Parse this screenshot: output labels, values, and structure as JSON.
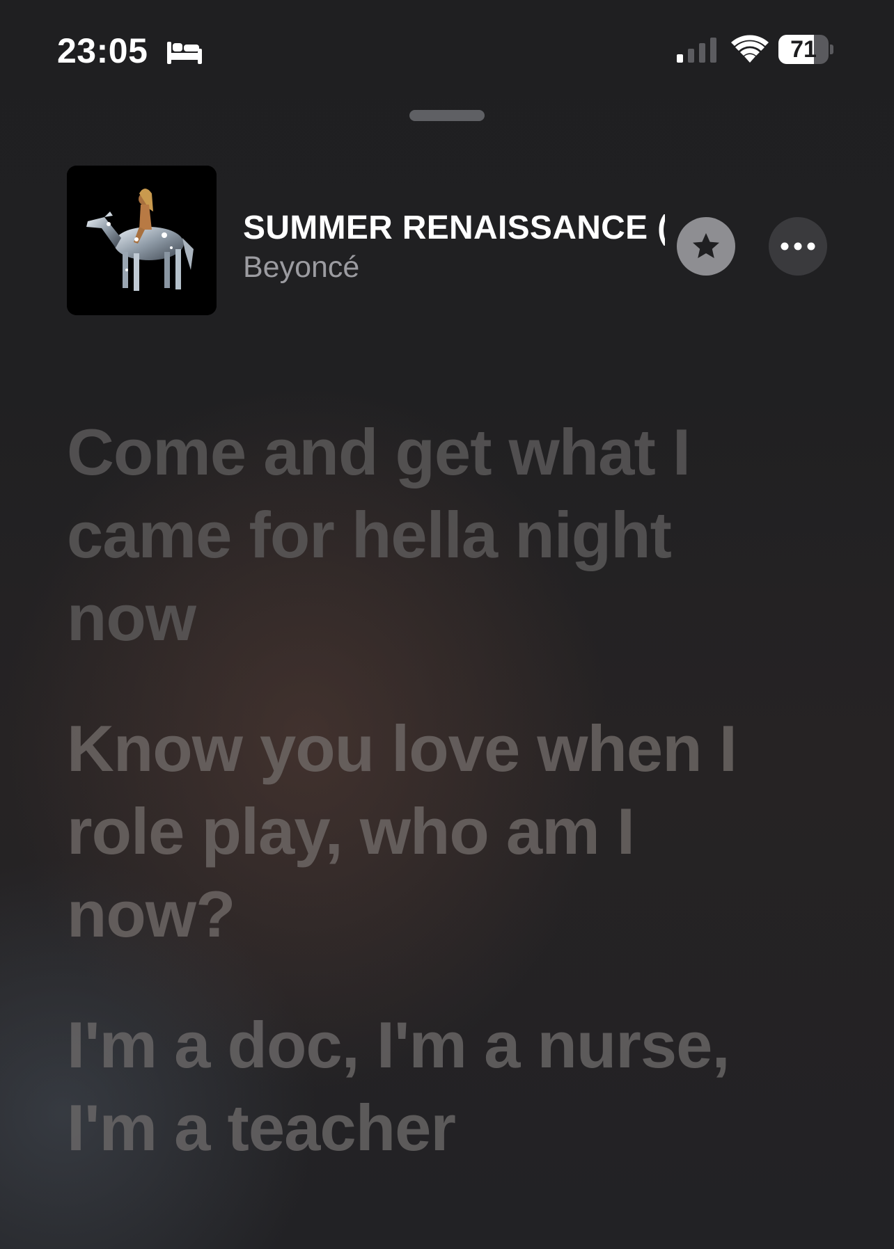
{
  "status_bar": {
    "time": "23:05",
    "focus_icon": "bed-icon",
    "signal_icon": "cellular-signal-icon",
    "wifi_icon": "wifi-icon",
    "battery_percent": "71",
    "battery_level": 0.71
  },
  "sheet": {
    "grabber_icon": "sheet-grabber"
  },
  "now_playing": {
    "title": "SUMMER RENAISSANCE (",
    "artist": "Beyoncé",
    "favorite_icon": "star-icon",
    "more_icon": "ellipsis-icon"
  },
  "lyrics": [
    "Come and get what I came for hella night now",
    "Know you love when I role play, who am I now?",
    "I'm a doc, I'm a nurse, I'm a teacher"
  ],
  "colors": {
    "background": "#1d1d1f",
    "title_text": "#ffffff",
    "artist_text": "#9c9ca1",
    "lyric_text": "#6e6a69",
    "star_button": "#8e8e92",
    "more_button": "#3a3a3d"
  }
}
